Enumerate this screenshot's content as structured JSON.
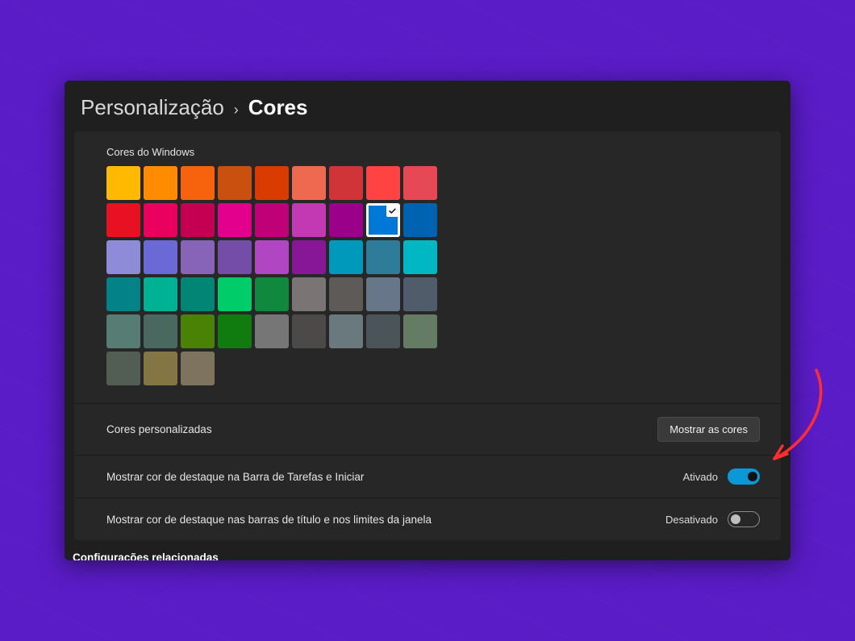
{
  "breadcrumb": {
    "parent": "Personalização",
    "current": "Cores"
  },
  "windows_colors_label": "Cores do Windows",
  "color_rows": [
    [
      "#ffb900",
      "#ff8c00",
      "#f7630c",
      "#ca5010",
      "#da3b01",
      "#ef6950",
      "#d13438",
      "#ff4343",
      "#e74856"
    ],
    [
      "#e81123",
      "#ea005e",
      "#c30052",
      "#e3008c",
      "#bf0077",
      "#c239b3",
      "#9a0089",
      "#0078d7",
      "#0063b1"
    ],
    [
      "#8e8cd8",
      "#6b69d6",
      "#8764b8",
      "#744da9",
      "#b146c2",
      "#881798",
      "#0099bc",
      "#2d7d9a",
      "#00b7c3"
    ],
    [
      "#038387",
      "#00b294",
      "#018574",
      "#00cc6a",
      "#10893e",
      "#7a7574",
      "#5d5a58",
      "#68768a",
      "#515c6b"
    ],
    [
      "#567c73",
      "#486860",
      "#498205",
      "#107c10",
      "#767676",
      "#4c4a48",
      "#69797e",
      "#4a5459",
      "#647c64"
    ],
    [
      "#525e54",
      "#847545",
      "#7e735f"
    ]
  ],
  "selected_color_index": {
    "row": 1,
    "col": 7
  },
  "custom_colors": {
    "label": "Cores personalizadas",
    "button": "Mostrar as cores"
  },
  "accent_taskbar": {
    "label": "Mostrar cor de destaque na Barra de Tarefas e Iniciar",
    "state_text": "Ativado",
    "enabled": true
  },
  "accent_titlebar": {
    "label": "Mostrar cor de destaque nas barras de título e nos limites da janela",
    "state_text": "Desativado",
    "enabled": false
  },
  "related_settings_heading": "Configurações relacionadas",
  "accent_on_color": "#0a99d6",
  "annotation_color": "#ff2e2e"
}
